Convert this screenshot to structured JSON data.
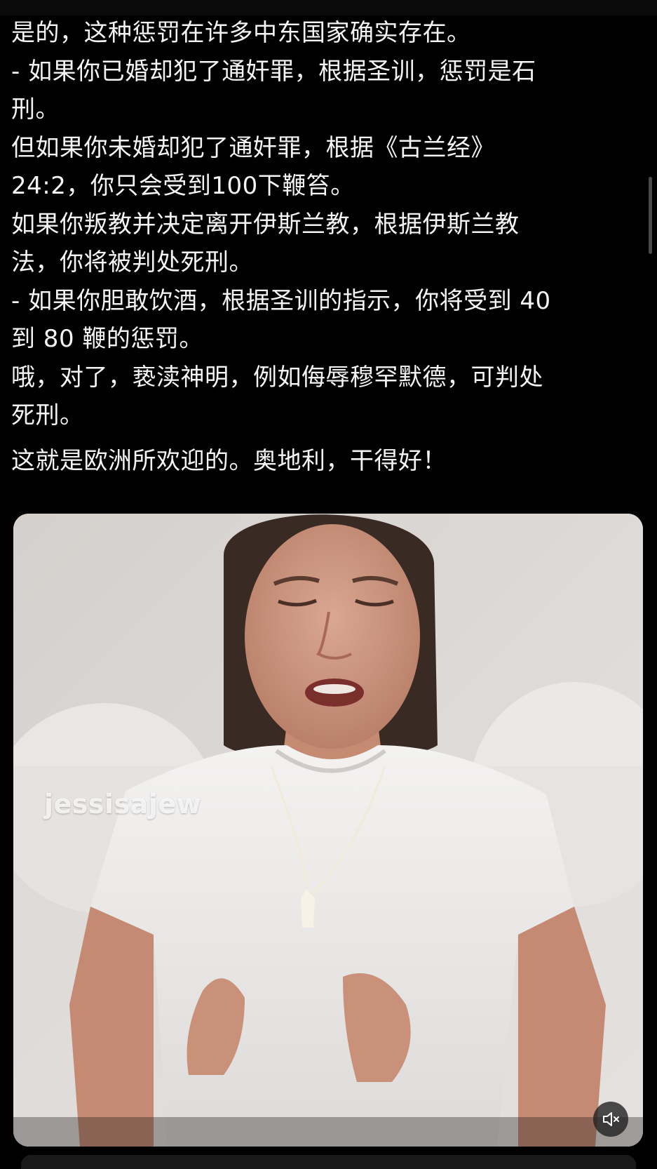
{
  "post": {
    "paragraphs": [
      "是的，这种惩罚在许多中东国家确实存在。",
      "- 如果你已婚却犯了通奸罪，根据圣训，惩罚是石\n刑。",
      "但如果你未婚却犯了通奸罪，根据《古兰经》\n24:2，你只会受到100下鞭笞。",
      "如果你叛教并决定离开伊斯兰教，根据伊斯兰教\n法，你将被判处死刑。",
      "- 如果你胆敢饮酒，根据圣训的指示，你将受到 40\n到 80 鞭的惩罚。",
      "哦，对了，亵渎神明，例如侮辱穆罕默德，可判处\n死刑。"
    ],
    "closing": "这就是欧洲所欢迎的。奥地利，干得好！"
  },
  "video": {
    "watermark": "jessisajew",
    "mute_icon": "speaker-muted-icon"
  },
  "colors": {
    "background": "#000000",
    "text": "#f4f4f4",
    "card_background": "#d9d6d4"
  }
}
